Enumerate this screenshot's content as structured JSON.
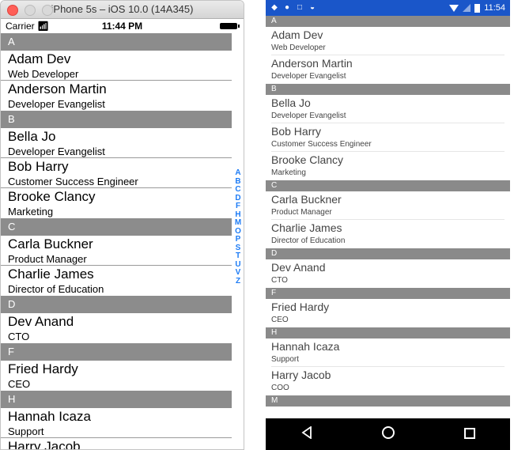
{
  "ios": {
    "window_title": "iPhone 5s – iOS 10.0 (14A345)",
    "carrier": "Carrier",
    "time": "11:44 PM",
    "sections": [
      {
        "letter": "A",
        "items": [
          {
            "name": "Adam Dev",
            "title": "Web Developer"
          },
          {
            "name": "Anderson Martin",
            "title": "Developer Evangelist"
          }
        ]
      },
      {
        "letter": "B",
        "items": [
          {
            "name": "Bella Jo",
            "title": "Developer Evangelist"
          },
          {
            "name": "Bob Harry",
            "title": "Customer Success Engineer"
          },
          {
            "name": "Brooke Clancy",
            "title": "Marketing"
          }
        ]
      },
      {
        "letter": "C",
        "items": [
          {
            "name": "Carla Buckner",
            "title": "Product Manager"
          },
          {
            "name": "Charlie James",
            "title": "Director of Education"
          }
        ]
      },
      {
        "letter": "D",
        "items": [
          {
            "name": "Dev Anand",
            "title": "CTO"
          }
        ]
      },
      {
        "letter": "F",
        "items": [
          {
            "name": "Fried Hardy",
            "title": "CEO"
          }
        ]
      },
      {
        "letter": "H",
        "items": [
          {
            "name": "Hannah Icaza",
            "title": "Support"
          },
          {
            "name": "Harry Jacob",
            "title": ""
          }
        ]
      }
    ],
    "index_letters": [
      "A",
      "B",
      "C",
      "D",
      "F",
      "H",
      "M",
      "O",
      "P",
      "S",
      "T",
      "U",
      "V",
      "Z"
    ]
  },
  "android": {
    "time": "11:54",
    "sections": [
      {
        "letter": "A",
        "items": [
          {
            "name": "Adam Dev",
            "title": "Web Developer"
          },
          {
            "name": "Anderson Martin",
            "title": "Developer Evangelist"
          }
        ]
      },
      {
        "letter": "B",
        "items": [
          {
            "name": "Bella Jo",
            "title": "Developer Evangelist"
          },
          {
            "name": "Bob Harry",
            "title": "Customer Success Engineer"
          },
          {
            "name": "Brooke Clancy",
            "title": "Marketing"
          }
        ]
      },
      {
        "letter": "C",
        "items": [
          {
            "name": "Carla Buckner",
            "title": "Product Manager"
          },
          {
            "name": "Charlie James",
            "title": "Director of Education"
          }
        ]
      },
      {
        "letter": "D",
        "items": [
          {
            "name": "Dev Anand",
            "title": "CTO"
          }
        ]
      },
      {
        "letter": "F",
        "items": [
          {
            "name": "Fried Hardy",
            "title": "CEO"
          }
        ]
      },
      {
        "letter": "H",
        "items": [
          {
            "name": "Hannah Icaza",
            "title": "Support"
          },
          {
            "name": "Harry Jacob",
            "title": "COO"
          }
        ]
      },
      {
        "letter": "M",
        "items": []
      }
    ],
    "nav": {
      "back_icon": "back-triangle-icon",
      "home_icon": "home-circle-icon",
      "recents_icon": "recents-square-icon"
    }
  }
}
